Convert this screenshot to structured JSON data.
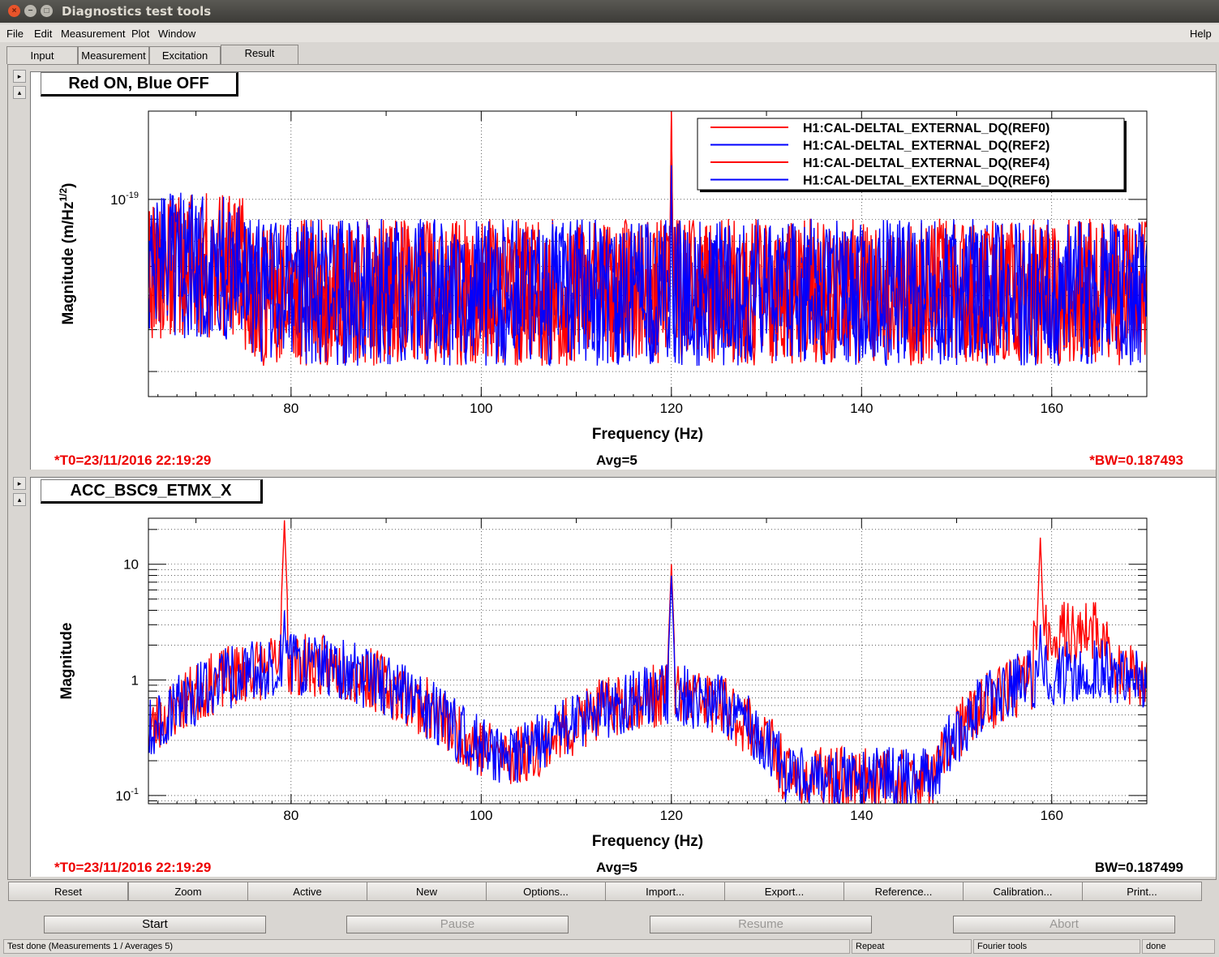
{
  "window": {
    "title": "Diagnostics test tools",
    "buttons": [
      "close",
      "minimize",
      "maximize"
    ]
  },
  "menubar": {
    "items": [
      "File",
      "Edit",
      "Measurement",
      "Plot",
      "Window"
    ],
    "help": "Help"
  },
  "tabs": [
    {
      "label": "Input"
    },
    {
      "label": "Measurement"
    },
    {
      "label": "Excitation"
    },
    {
      "label": "Result",
      "active": true
    }
  ],
  "colors": {
    "ref0": "#ff0000",
    "ref2": "#0000ff",
    "ref4": "#ff0000",
    "ref6": "#0000ff"
  },
  "panel1": {
    "title": "Red ON, Blue OFF",
    "chart_data": {
      "type": "line",
      "xlabel": "Frequency (Hz)",
      "ylabel": "Magnitude (m/Hz^(1/2))",
      "ylabel_parts": {
        "base": "Magnitude (m/Hz",
        "sup": "1/2",
        "end": ")"
      },
      "ytick_label": {
        "base": "10",
        "exp": "-19"
      },
      "xlim": [
        65,
        170
      ],
      "ylim": [
        3.5e-20,
        1.6e-19
      ],
      "yscale": "log",
      "xticks": [
        "80",
        "100",
        "120",
        "140",
        "160"
      ],
      "grid": true,
      "legend_position": "top-right",
      "series": [
        {
          "name": "H1:CAL-DELTAL_EXTERNAL_DQ(REF0)",
          "color": "#ff0000",
          "baseline": 6.2e-20,
          "peaks": [
            {
              "x": 120,
              "y": 1.6e-19
            }
          ]
        },
        {
          "name": "H1:CAL-DELTAL_EXTERNAL_DQ(REF2)",
          "color": "#0000ff",
          "baseline": 6e-20,
          "peaks": [
            {
              "x": 120,
              "y": 1.2e-19
            }
          ]
        },
        {
          "name": "H1:CAL-DELTAL_EXTERNAL_DQ(REF4)",
          "color": "#ff0000",
          "baseline": 6.2e-20,
          "peaks": [
            {
              "x": 120,
              "y": 1.6e-19
            }
          ]
        },
        {
          "name": "H1:CAL-DELTAL_EXTERNAL_DQ(REF6)",
          "color": "#0000ff",
          "baseline": 6e-20,
          "peaks": [
            {
              "x": 120,
              "y": 1.2e-19
            }
          ]
        }
      ]
    },
    "t0": "*T0=23/11/2016 22:19:29",
    "avg": "Avg=5",
    "bw": "*BW=0.187493"
  },
  "panel2": {
    "title": "ACC_BSC9_ETMX_X",
    "chart_data": {
      "type": "line",
      "xlabel": "Frequency (Hz)",
      "ylabel": "Magnitude",
      "xlim": [
        65,
        170
      ],
      "ylim": [
        0.085,
        25
      ],
      "yscale": "log",
      "xticks": [
        "80",
        "100",
        "120",
        "140",
        "160"
      ],
      "yticks": [
        {
          "v": 10,
          "label": "10"
        },
        {
          "v": 1,
          "label": "1"
        },
        {
          "v": 0.1,
          "label": "10",
          "exp": "-1"
        }
      ],
      "grid": true,
      "series": [
        {
          "color": "#ff0000",
          "peaks": [
            {
              "x": 79.3,
              "y": 24
            },
            {
              "x": 120,
              "y": 10
            },
            {
              "x": 158.8,
              "y": 17
            }
          ]
        },
        {
          "color": "#0000ff",
          "peaks": [
            {
              "x": 79.3,
              "y": 4
            },
            {
              "x": 120,
              "y": 8
            },
            {
              "x": 158.8,
              "y": 3
            }
          ]
        }
      ]
    },
    "t0": "*T0=23/11/2016 22:19:29",
    "avg": "Avg=5",
    "bw": "BW=0.187499"
  },
  "toolbar": [
    "Reset",
    "Zoom",
    "Active",
    "New",
    "Options...",
    "Import...",
    "Export...",
    "Reference...",
    "Calibration...",
    "Print..."
  ],
  "bottom_buttons": [
    {
      "label": "Start",
      "enabled": true
    },
    {
      "label": "Pause",
      "enabled": false
    },
    {
      "label": "Resume",
      "enabled": false
    },
    {
      "label": "Abort",
      "enabled": false
    }
  ],
  "status": {
    "message": "Test done (Measurements 1 / Averages 5)",
    "repeat": "Repeat",
    "tool": "Fourier tools",
    "state": "done"
  }
}
